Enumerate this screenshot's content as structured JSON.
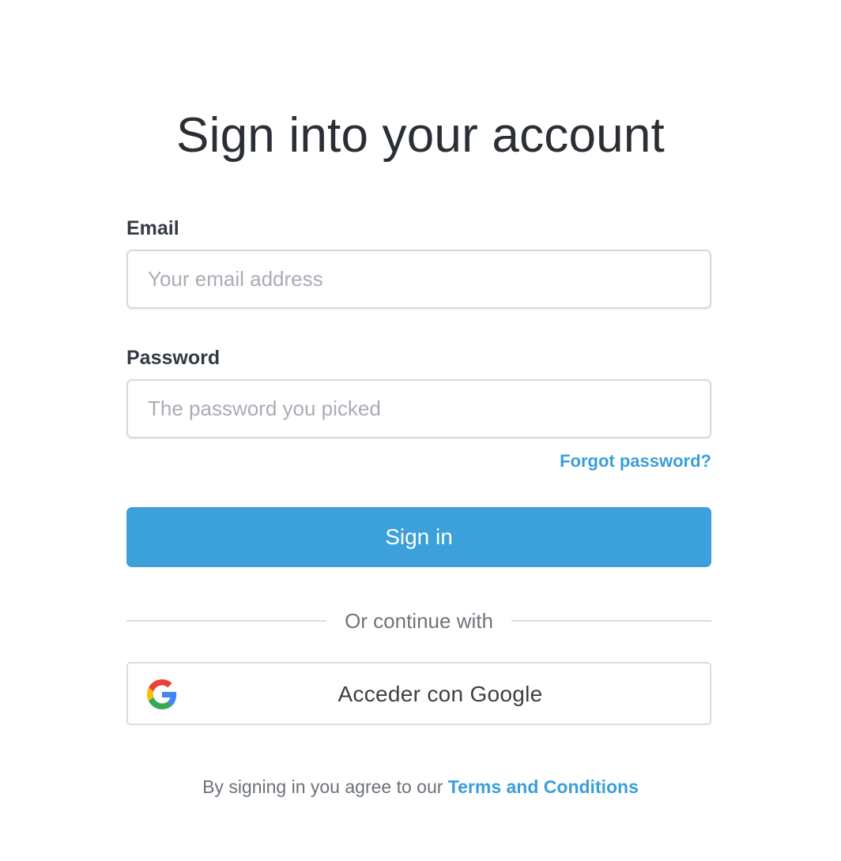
{
  "page": {
    "title": "Sign into your account"
  },
  "form": {
    "email": {
      "label": "Email",
      "value": "",
      "placeholder": "Your email address"
    },
    "password": {
      "label": "Password",
      "value": "",
      "placeholder": "The password you picked"
    },
    "forgot_password_label": "Forgot password?",
    "submit_label": "Sign in"
  },
  "divider": {
    "label": "Or continue with"
  },
  "social": {
    "google_label": "Acceder con Google",
    "google_icon": "google-g-icon"
  },
  "footer": {
    "text": "By signing in you agree to our",
    "link_label": "Terms and Conditions"
  },
  "colors": {
    "accent": "#3ca0db",
    "link": "#3a9fd9",
    "title": "#2a2f35",
    "muted": "#6e747c",
    "border": "#d6d8dc"
  }
}
